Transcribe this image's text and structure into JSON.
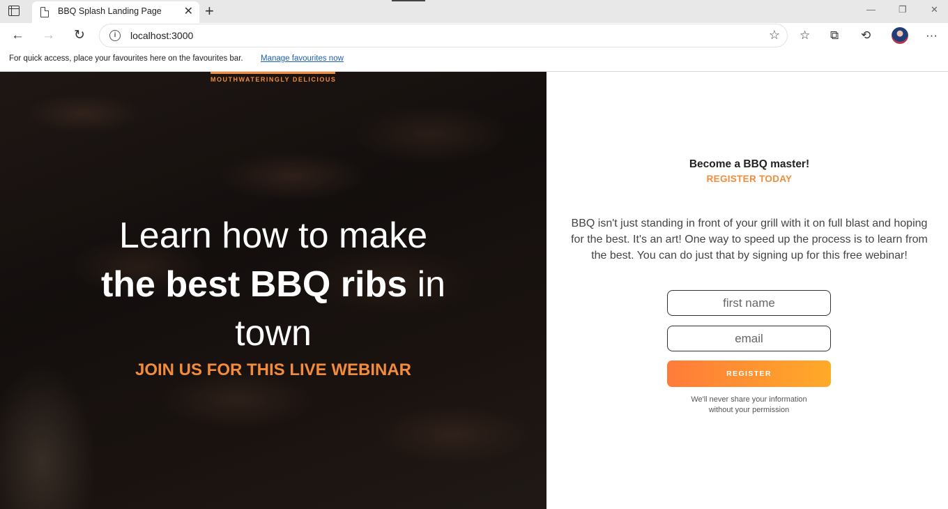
{
  "browser": {
    "tab_title": "BBQ Splash Landing Page",
    "tab_close": "✕",
    "new_tab": "+",
    "url": "localhost:3000",
    "favourites_bar_text": "For quick access, place your favourites here on the favourites bar.",
    "favourites_bar_link": "Manage favourites now",
    "window_controls": {
      "minimize": "—",
      "restore": "❐",
      "close": "✕"
    }
  },
  "hero": {
    "tagline": "MOUTHWATERINGLY DELICIOUS",
    "headline_line1": "Learn how to make",
    "headline_bold": "the best BBQ ribs",
    "headline_after_bold": " in",
    "headline_line3": "town",
    "subheadline": "JOIN US FOR THIS LIVE WEBINAR"
  },
  "signup": {
    "title": "Become a BBQ master!",
    "cta": "REGISTER TODAY",
    "description": "BBQ isn't just standing in front of your grill with it on full blast and hoping for the best. It's an art! One way to speed up the process is to learn from the best. You can do just that by signing up for this free webinar!",
    "first_name_placeholder": "first name",
    "email_placeholder": "email",
    "register_label": "REGISTER",
    "privacy_line1": "We'll never share your information",
    "privacy_line2": "without your permission"
  },
  "colors": {
    "accent": "#f28c3a",
    "button_gradient_start": "#ff7b3a",
    "button_gradient_end": "#ffaa28"
  }
}
